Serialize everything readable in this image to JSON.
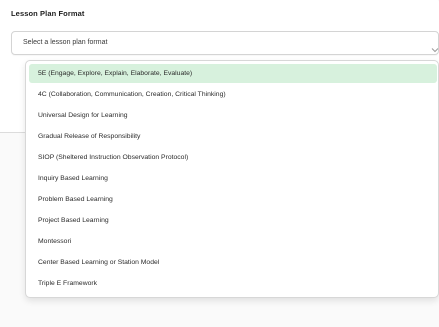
{
  "form": {
    "field_label": "Lesson Plan Format",
    "select_placeholder": "Select a lesson plan format"
  },
  "dropdown": {
    "options": [
      "5E (Engage, Explore, Explain, Elaborate, Evaluate)",
      "4C (Collaboration, Communication, Creation, Critical Thinking)",
      "Universal Design for Learning",
      "Gradual Release of Responsibility",
      "SIOP (Sheltered Instruction Observation Protocol)",
      "Inquiry Based Learning",
      "Problem Based Learning",
      "Project Based Learning",
      "Montessori",
      "Center Based Learning or Station Model",
      "Triple E Framework"
    ],
    "highlighted_index": 0
  },
  "colors": {
    "highlight": "#d7f1dd",
    "border": "#d7d7d7"
  },
  "icons": {
    "select_chevron": "chevron-down-icon"
  }
}
